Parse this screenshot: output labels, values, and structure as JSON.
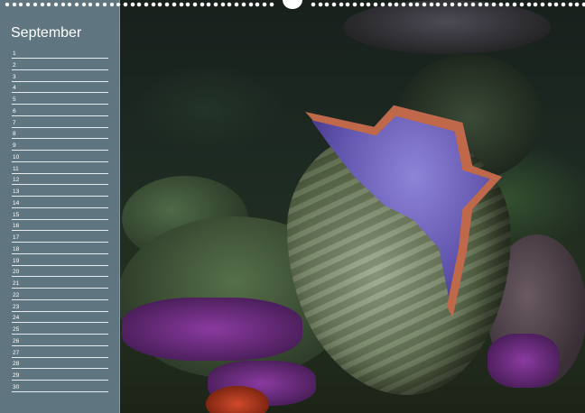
{
  "calendar": {
    "month": "September",
    "days": [
      "1",
      "2",
      "3",
      "4",
      "5",
      "6",
      "7",
      "8",
      "9",
      "10",
      "11",
      "12",
      "13",
      "14",
      "15",
      "16",
      "17",
      "18",
      "19",
      "20",
      "21",
      "22",
      "23",
      "24",
      "25",
      "26",
      "27",
      "28",
      "29",
      "30"
    ]
  },
  "colors": {
    "sidebar": "#5f7680",
    "clam_mantle": "#6a5cc0",
    "coral_purple": "#8a3aa0"
  },
  "photo": {
    "subject": "giant clam underwater"
  }
}
